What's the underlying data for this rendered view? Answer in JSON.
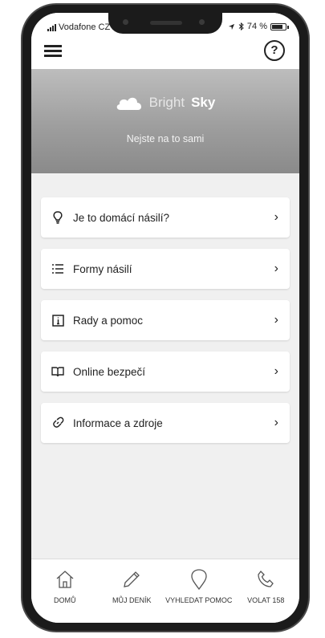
{
  "status": {
    "carrier": "Vodafone CZ",
    "battery": "74 %"
  },
  "brand": {
    "name_light": "Bright",
    "name_bold": "Sky",
    "tagline": "Nejste na to sami"
  },
  "menu": [
    {
      "label": "Je to domácí násilí?",
      "icon": "lightbulb-icon"
    },
    {
      "label": "Formy násilí",
      "icon": "list-icon"
    },
    {
      "label": "Rady a pomoc",
      "icon": "info-icon"
    },
    {
      "label": "Online bezpečí",
      "icon": "book-icon"
    },
    {
      "label": "Informace a zdroje",
      "icon": "link-icon"
    }
  ],
  "nav": [
    {
      "label": "DOMŮ",
      "icon": "home-icon"
    },
    {
      "label": "MŮJ DENÍK",
      "icon": "pencil-icon"
    },
    {
      "label": "VYHLEDAT POMOC",
      "icon": "location-pin-icon"
    },
    {
      "label": "VOLAT 158",
      "icon": "phone-icon"
    }
  ]
}
